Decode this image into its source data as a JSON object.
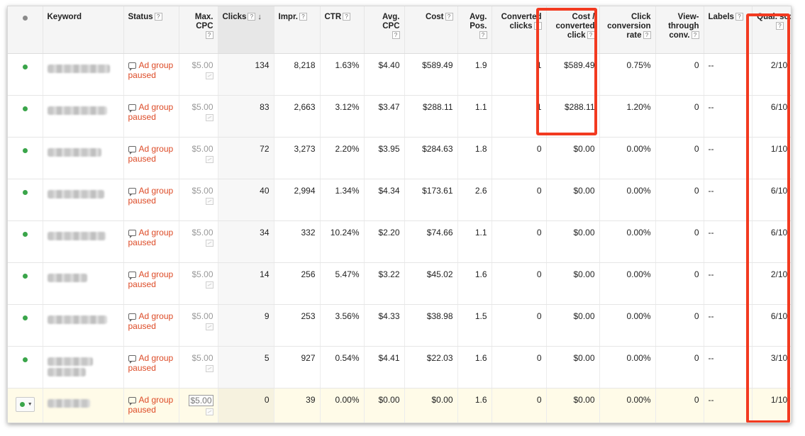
{
  "headers": {
    "keyword": "Keyword",
    "status": "Status",
    "max_cpc": "Max. CPC",
    "clicks": "Clicks",
    "impr": "Impr.",
    "ctr": "CTR",
    "avg_cpc": "Avg. CPC",
    "cost": "Cost",
    "avg_pos": "Avg. Pos.",
    "converted_clicks": "Converted clicks",
    "cost_per_conv": "Cost / converted click",
    "click_conv_rate": "Click conversion rate",
    "view_through": "View-through conv.",
    "labels": "Labels",
    "qual_score": "Qual. score",
    "help_glyph": "?"
  },
  "status_text": "Ad group paused",
  "rows": [
    {
      "max_cpc": "$5.00",
      "clicks": "134",
      "impr": "8,218",
      "ctr": "1.63%",
      "avg_cpc": "$4.40",
      "cost": "$589.49",
      "avg_pos": "1.9",
      "converted_clicks": "1",
      "cost_per_conv": "$589.49",
      "click_conv_rate": "0.75%",
      "view_through": "0",
      "labels": "--",
      "qual_score": "2/10"
    },
    {
      "max_cpc": "$5.00",
      "clicks": "83",
      "impr": "2,663",
      "ctr": "3.12%",
      "avg_cpc": "$3.47",
      "cost": "$288.11",
      "avg_pos": "1.1",
      "converted_clicks": "1",
      "cost_per_conv": "$288.11",
      "click_conv_rate": "1.20%",
      "view_through": "0",
      "labels": "--",
      "qual_score": "6/10"
    },
    {
      "max_cpc": "$5.00",
      "clicks": "72",
      "impr": "3,273",
      "ctr": "2.20%",
      "avg_cpc": "$3.95",
      "cost": "$284.63",
      "avg_pos": "1.8",
      "converted_clicks": "0",
      "cost_per_conv": "$0.00",
      "click_conv_rate": "0.00%",
      "view_through": "0",
      "labels": "--",
      "qual_score": "1/10"
    },
    {
      "max_cpc": "$5.00",
      "clicks": "40",
      "impr": "2,994",
      "ctr": "1.34%",
      "avg_cpc": "$4.34",
      "cost": "$173.61",
      "avg_pos": "2.6",
      "converted_clicks": "0",
      "cost_per_conv": "$0.00",
      "click_conv_rate": "0.00%",
      "view_through": "0",
      "labels": "--",
      "qual_score": "6/10"
    },
    {
      "max_cpc": "$5.00",
      "clicks": "34",
      "impr": "332",
      "ctr": "10.24%",
      "avg_cpc": "$2.20",
      "cost": "$74.66",
      "avg_pos": "1.1",
      "converted_clicks": "0",
      "cost_per_conv": "$0.00",
      "click_conv_rate": "0.00%",
      "view_through": "0",
      "labels": "--",
      "qual_score": "6/10"
    },
    {
      "max_cpc": "$5.00",
      "clicks": "14",
      "impr": "256",
      "ctr": "5.47%",
      "avg_cpc": "$3.22",
      "cost": "$45.02",
      "avg_pos": "1.6",
      "converted_clicks": "0",
      "cost_per_conv": "$0.00",
      "click_conv_rate": "0.00%",
      "view_through": "0",
      "labels": "--",
      "qual_score": "2/10"
    },
    {
      "max_cpc": "$5.00",
      "clicks": "9",
      "impr": "253",
      "ctr": "3.56%",
      "avg_cpc": "$4.33",
      "cost": "$38.98",
      "avg_pos": "1.5",
      "converted_clicks": "0",
      "cost_per_conv": "$0.00",
      "click_conv_rate": "0.00%",
      "view_through": "0",
      "labels": "--",
      "qual_score": "6/10"
    },
    {
      "max_cpc": "$5.00",
      "clicks": "5",
      "impr": "927",
      "ctr": "0.54%",
      "avg_cpc": "$4.41",
      "cost": "$22.03",
      "avg_pos": "1.6",
      "converted_clicks": "0",
      "cost_per_conv": "$0.00",
      "click_conv_rate": "0.00%",
      "view_through": "0",
      "labels": "--",
      "qual_score": "3/10"
    },
    {
      "max_cpc": "$5.00",
      "clicks": "0",
      "impr": "39",
      "ctr": "0.00%",
      "avg_cpc": "$0.00",
      "cost": "$0.00",
      "avg_pos": "1.6",
      "converted_clicks": "0",
      "cost_per_conv": "$0.00",
      "click_conv_rate": "0.00%",
      "view_through": "0",
      "labels": "--",
      "qual_score": "1/10"
    }
  ],
  "icons": {
    "enabled_dot": "green-dot-icon",
    "sort": "sort-down-arrow-icon",
    "status": "speech-bubble-icon",
    "max_cpc_chart": "bid-chart-icon"
  },
  "colors": {
    "enabled": "#3aa54a",
    "paused_status": "#dd4b27",
    "highlight_box": "#f23a20",
    "selected_row": "#fffbe8"
  }
}
